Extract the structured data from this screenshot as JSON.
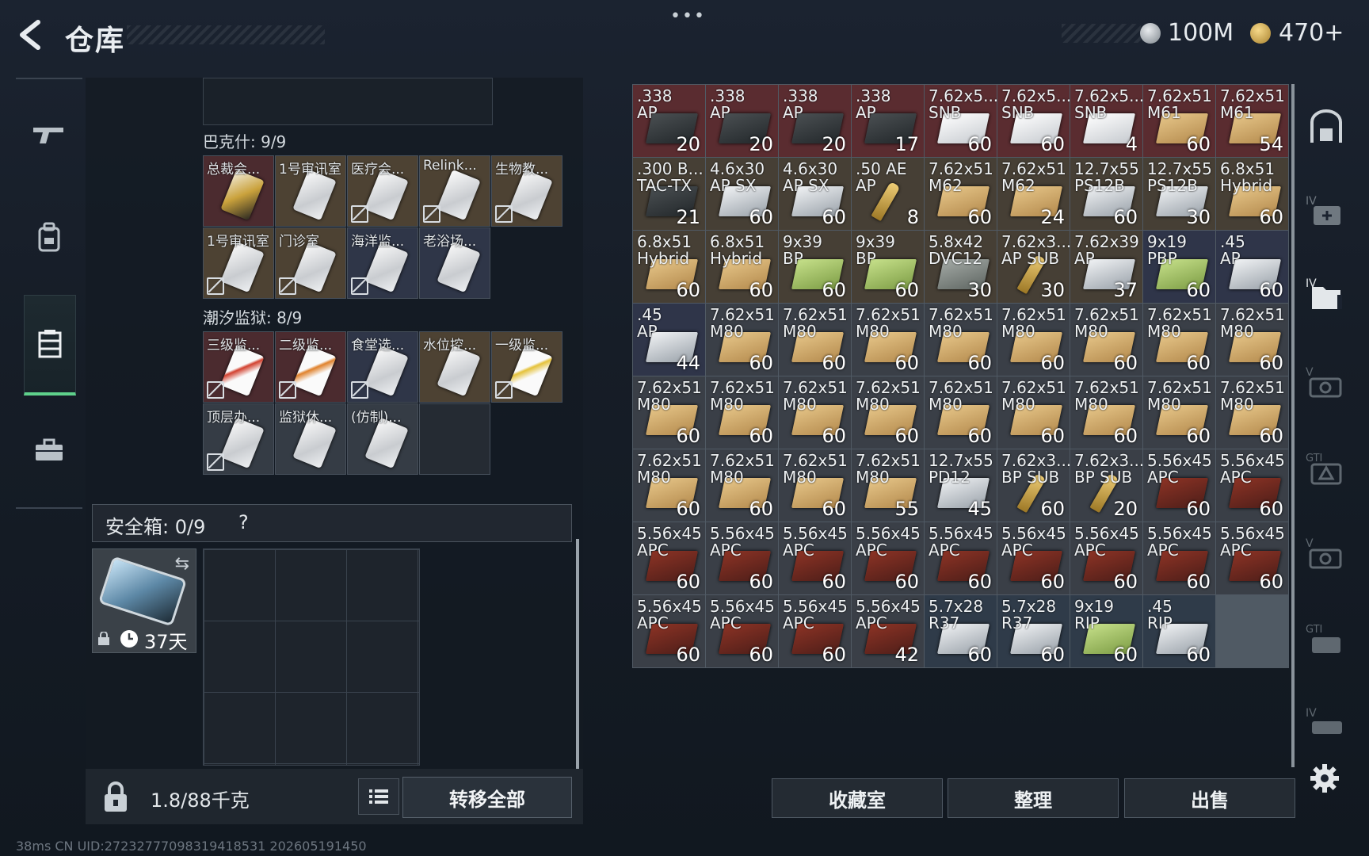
{
  "header": {
    "title": "仓库",
    "currency1": "100M",
    "currency2": "470+"
  },
  "sections": {
    "baksh": {
      "title": "巴克什: 9/9",
      "items": [
        {
          "label": "总裁会...",
          "bg": "bg-red",
          "locked": false,
          "card": "gold"
        },
        {
          "label": "1号审讯室",
          "bg": "bg-gold",
          "locked": false
        },
        {
          "label": "医疗会...",
          "bg": "bg-gold",
          "locked": true
        },
        {
          "label": "Relink...",
          "bg": "bg-gold",
          "locked": true
        },
        {
          "label": "生物教...",
          "bg": "bg-gold",
          "locked": true
        },
        {
          "label": "1号审讯室",
          "bg": "bg-gold",
          "locked": true
        },
        {
          "label": "门诊室",
          "bg": "bg-gold",
          "locked": true
        },
        {
          "label": "海洋监...",
          "bg": "bg-blue",
          "locked": true
        },
        {
          "label": "老浴场...",
          "bg": "bg-blue",
          "locked": false
        }
      ]
    },
    "tidal": {
      "title": "潮汐监狱: 8/9",
      "items": [
        {
          "label": "三级监...",
          "bg": "bg-red",
          "locked": true,
          "card": "red"
        },
        {
          "label": "二级监...",
          "bg": "bg-red",
          "locked": true,
          "card": "orange"
        },
        {
          "label": "食堂选...",
          "bg": "bg-blue",
          "locked": true
        },
        {
          "label": "水位控...",
          "bg": "bg-gold",
          "locked": false
        },
        {
          "label": "一级监...",
          "bg": "bg-gold",
          "locked": true,
          "card": "yellow"
        },
        {
          "label": "顶层办...",
          "bg": "bg-gray",
          "locked": true
        },
        {
          "label": "监狱休...",
          "bg": "bg-gray",
          "locked": false
        },
        {
          "label": "(仿制)...",
          "bg": "bg-gray",
          "locked": false
        },
        {
          "label": "",
          "bg": "bg-empty",
          "locked": false,
          "empty": true
        }
      ]
    }
  },
  "safebox": {
    "title": "安全箱: 0/9",
    "help": "?",
    "days": "37天"
  },
  "weight": {
    "text": "1.8/88千克"
  },
  "buttons": {
    "transfer_all": "转移全部",
    "collection": "收藏室",
    "organize": "整理",
    "sell": "出售"
  },
  "status": {
    "text": "38ms    CN UID:27232777098319418531 202605191450"
  },
  "inventory": [
    {
      "n": ".338",
      "t": "AP",
      "c": "20",
      "bg": "#5a2c30",
      "k": "k-darkcase"
    },
    {
      "n": ".338",
      "t": "AP",
      "c": "20",
      "bg": "#5a2c30",
      "k": "k-darkcase"
    },
    {
      "n": ".338",
      "t": "AP",
      "c": "20",
      "bg": "#5a2c30",
      "k": "k-darkcase"
    },
    {
      "n": ".338",
      "t": "AP",
      "c": "17",
      "bg": "#5a2c30",
      "k": "k-darkcase"
    },
    {
      "n": "7.62x5...",
      "t": "SNB",
      "c": "60",
      "bg": "#5a2c30",
      "k": "k-white"
    },
    {
      "n": "7.62x5...",
      "t": "SNB",
      "c": "60",
      "bg": "#5a2c30",
      "k": "k-white"
    },
    {
      "n": "7.62x5...",
      "t": "SNB",
      "c": "4",
      "bg": "#5a2c30",
      "k": "k-white"
    },
    {
      "n": "7.62x51",
      "t": "M61",
      "c": "60",
      "bg": "#5a2c30",
      "k": "k-cardboard"
    },
    {
      "n": "7.62x51",
      "t": "M61",
      "c": "54",
      "bg": "#5a2c30",
      "k": "k-cardboard"
    },
    {
      "n": ".300 B...",
      "t": "TAC-TX",
      "c": "21",
      "bg": "#463f35",
      "k": "k-darkcase"
    },
    {
      "n": "4.6x30",
      "t": "AP SX",
      "c": "60",
      "bg": "#463f35",
      "k": "k-silver"
    },
    {
      "n": "4.6x30",
      "t": "AP SX",
      "c": "60",
      "bg": "#463f35",
      "k": "k-silver"
    },
    {
      "n": ".50 AE",
      "t": "AP",
      "c": "8",
      "bg": "#463f35",
      "k": "k-bullet"
    },
    {
      "n": "7.62x51",
      "t": "M62",
      "c": "60",
      "bg": "#463f35",
      "k": "k-cardboard"
    },
    {
      "n": "7.62x51",
      "t": "M62",
      "c": "24",
      "bg": "#463f35",
      "k": "k-cardboard"
    },
    {
      "n": "12.7x55",
      "t": "PS12B",
      "c": "60",
      "bg": "#463f35",
      "k": "k-silver"
    },
    {
      "n": "12.7x55",
      "t": "PS12B",
      "c": "30",
      "bg": "#463f35",
      "k": "k-silver"
    },
    {
      "n": "6.8x51",
      "t": "Hybrid",
      "c": "60",
      "bg": "#463f35",
      "k": "k-cardboard"
    },
    {
      "n": "6.8x51",
      "t": "Hybrid",
      "c": "60",
      "bg": "#463f35",
      "k": "k-cardboard"
    },
    {
      "n": "6.8x51",
      "t": "Hybrid",
      "c": "60",
      "bg": "#463f35",
      "k": "k-cardboard"
    },
    {
      "n": "9x39",
      "t": "BP",
      "c": "60",
      "bg": "#463f35",
      "k": "k-green"
    },
    {
      "n": "9x39",
      "t": "BP",
      "c": "60",
      "bg": "#463f35",
      "k": "k-green"
    },
    {
      "n": "5.8x42",
      "t": "DVC12",
      "c": "30",
      "bg": "#463f35",
      "k": "k-gray"
    },
    {
      "n": "7.62x3...",
      "t": "AP SUB",
      "c": "30",
      "bg": "#463f35",
      "k": "k-bullet"
    },
    {
      "n": "7.62x39",
      "t": "AP",
      "c": "37",
      "bg": "#463f35",
      "k": "k-silver"
    },
    {
      "n": "9x19",
      "t": "PBP",
      "c": "60",
      "bg": "#2f3549",
      "k": "k-green"
    },
    {
      "n": ".45",
      "t": "AP",
      "c": "60",
      "bg": "#2f3549",
      "k": "k-silver"
    },
    {
      "n": ".45",
      "t": "AP",
      "c": "44",
      "bg": "#2f3549",
      "k": "k-silver"
    },
    {
      "n": "7.62x51",
      "t": "M80",
      "c": "60",
      "bg": "#3a3f47",
      "k": "k-cardboard"
    },
    {
      "n": "7.62x51",
      "t": "M80",
      "c": "60",
      "bg": "#3a3f47",
      "k": "k-cardboard"
    },
    {
      "n": "7.62x51",
      "t": "M80",
      "c": "60",
      "bg": "#3a3f47",
      "k": "k-cardboard"
    },
    {
      "n": "7.62x51",
      "t": "M80",
      "c": "60",
      "bg": "#3a3f47",
      "k": "k-cardboard"
    },
    {
      "n": "7.62x51",
      "t": "M80",
      "c": "60",
      "bg": "#3a3f47",
      "k": "k-cardboard"
    },
    {
      "n": "7.62x51",
      "t": "M80",
      "c": "60",
      "bg": "#3a3f47",
      "k": "k-cardboard"
    },
    {
      "n": "7.62x51",
      "t": "M80",
      "c": "60",
      "bg": "#3a3f47",
      "k": "k-cardboard"
    },
    {
      "n": "7.62x51",
      "t": "M80",
      "c": "60",
      "bg": "#3a3f47",
      "k": "k-cardboard"
    },
    {
      "n": "7.62x51",
      "t": "M80",
      "c": "60",
      "bg": "#3a3f47",
      "k": "k-cardboard"
    },
    {
      "n": "7.62x51",
      "t": "M80",
      "c": "60",
      "bg": "#3a3f47",
      "k": "k-cardboard"
    },
    {
      "n": "7.62x51",
      "t": "M80",
      "c": "60",
      "bg": "#3a3f47",
      "k": "k-cardboard"
    },
    {
      "n": "7.62x51",
      "t": "M80",
      "c": "60",
      "bg": "#3a3f47",
      "k": "k-cardboard"
    },
    {
      "n": "7.62x51",
      "t": "M80",
      "c": "60",
      "bg": "#3a3f47",
      "k": "k-cardboard"
    },
    {
      "n": "7.62x51",
      "t": "M80",
      "c": "60",
      "bg": "#3a3f47",
      "k": "k-cardboard"
    },
    {
      "n": "7.62x51",
      "t": "M80",
      "c": "60",
      "bg": "#3a3f47",
      "k": "k-cardboard"
    },
    {
      "n": "7.62x51",
      "t": "M80",
      "c": "60",
      "bg": "#3a3f47",
      "k": "k-cardboard"
    },
    {
      "n": "7.62x51",
      "t": "M80",
      "c": "60",
      "bg": "#3a3f47",
      "k": "k-cardboard"
    },
    {
      "n": "7.62x51",
      "t": "M80",
      "c": "60",
      "bg": "#3a3f47",
      "k": "k-cardboard"
    },
    {
      "n": "7.62x51",
      "t": "M80",
      "c": "60",
      "bg": "#3a3f47",
      "k": "k-cardboard"
    },
    {
      "n": "7.62x51",
      "t": "M80",
      "c": "60",
      "bg": "#3a3f47",
      "k": "k-cardboard"
    },
    {
      "n": "7.62x51",
      "t": "M80",
      "c": "55",
      "bg": "#3a3f47",
      "k": "k-cardboard"
    },
    {
      "n": "12.7x55",
      "t": "PD12",
      "c": "45",
      "bg": "#3a3f47",
      "k": "k-silver"
    },
    {
      "n": "7.62x3...",
      "t": "BP SUB",
      "c": "60",
      "bg": "#3a3f47",
      "k": "k-bullet"
    },
    {
      "n": "7.62x3...",
      "t": "BP SUB",
      "c": "20",
      "bg": "#3a3f47",
      "k": "k-bullet"
    },
    {
      "n": "5.56x45",
      "t": "APC",
      "c": "60",
      "bg": "#3a3f47",
      "k": "k-redbox"
    },
    {
      "n": "5.56x45",
      "t": "APC",
      "c": "60",
      "bg": "#3a3f47",
      "k": "k-redbox"
    },
    {
      "n": "5.56x45",
      "t": "APC",
      "c": "60",
      "bg": "#3a3f47",
      "k": "k-redbox"
    },
    {
      "n": "5.56x45",
      "t": "APC",
      "c": "60",
      "bg": "#3a3f47",
      "k": "k-redbox"
    },
    {
      "n": "5.56x45",
      "t": "APC",
      "c": "60",
      "bg": "#3a3f47",
      "k": "k-redbox"
    },
    {
      "n": "5.56x45",
      "t": "APC",
      "c": "60",
      "bg": "#3a3f47",
      "k": "k-redbox"
    },
    {
      "n": "5.56x45",
      "t": "APC",
      "c": "60",
      "bg": "#3a3f47",
      "k": "k-redbox"
    },
    {
      "n": "5.56x45",
      "t": "APC",
      "c": "60",
      "bg": "#3a3f47",
      "k": "k-redbox"
    },
    {
      "n": "5.56x45",
      "t": "APC",
      "c": "60",
      "bg": "#3a3f47",
      "k": "k-redbox"
    },
    {
      "n": "5.56x45",
      "t": "APC",
      "c": "60",
      "bg": "#3a3f47",
      "k": "k-redbox"
    },
    {
      "n": "5.56x45",
      "t": "APC",
      "c": "60",
      "bg": "#3a3f47",
      "k": "k-redbox"
    },
    {
      "n": "5.56x45",
      "t": "APC",
      "c": "60",
      "bg": "#3a3f47",
      "k": "k-redbox"
    },
    {
      "n": "5.56x45",
      "t": "APC",
      "c": "60",
      "bg": "#3a3f47",
      "k": "k-redbox"
    },
    {
      "n": "5.56x45",
      "t": "APC",
      "c": "60",
      "bg": "#3a3f47",
      "k": "k-redbox"
    },
    {
      "n": "5.56x45",
      "t": "APC",
      "c": "42",
      "bg": "#3a3f47",
      "k": "k-redbox"
    },
    {
      "n": "5.7x28",
      "t": "R37",
      "c": "60",
      "bg": "#2f3b49",
      "k": "k-silver"
    },
    {
      "n": "5.7x28",
      "t": "R37",
      "c": "60",
      "bg": "#2f3b49",
      "k": "k-silver"
    },
    {
      "n": "9x19",
      "t": "RIP",
      "c": "60",
      "bg": "#2f3b49",
      "k": "k-green"
    },
    {
      "n": ".45",
      "t": "RIP",
      "c": "60",
      "bg": "#2f3b49",
      "k": "k-silver"
    }
  ],
  "right_icons": [
    "locker-icon",
    "iv-add-icon",
    "iv-folder-icon",
    "v-camera-icon",
    "gti-gear-icon",
    "v-camera-icon-2",
    "gti-bag-icon",
    "iv-case-icon"
  ],
  "colors": {
    "accent_green": "#5fd18b"
  }
}
